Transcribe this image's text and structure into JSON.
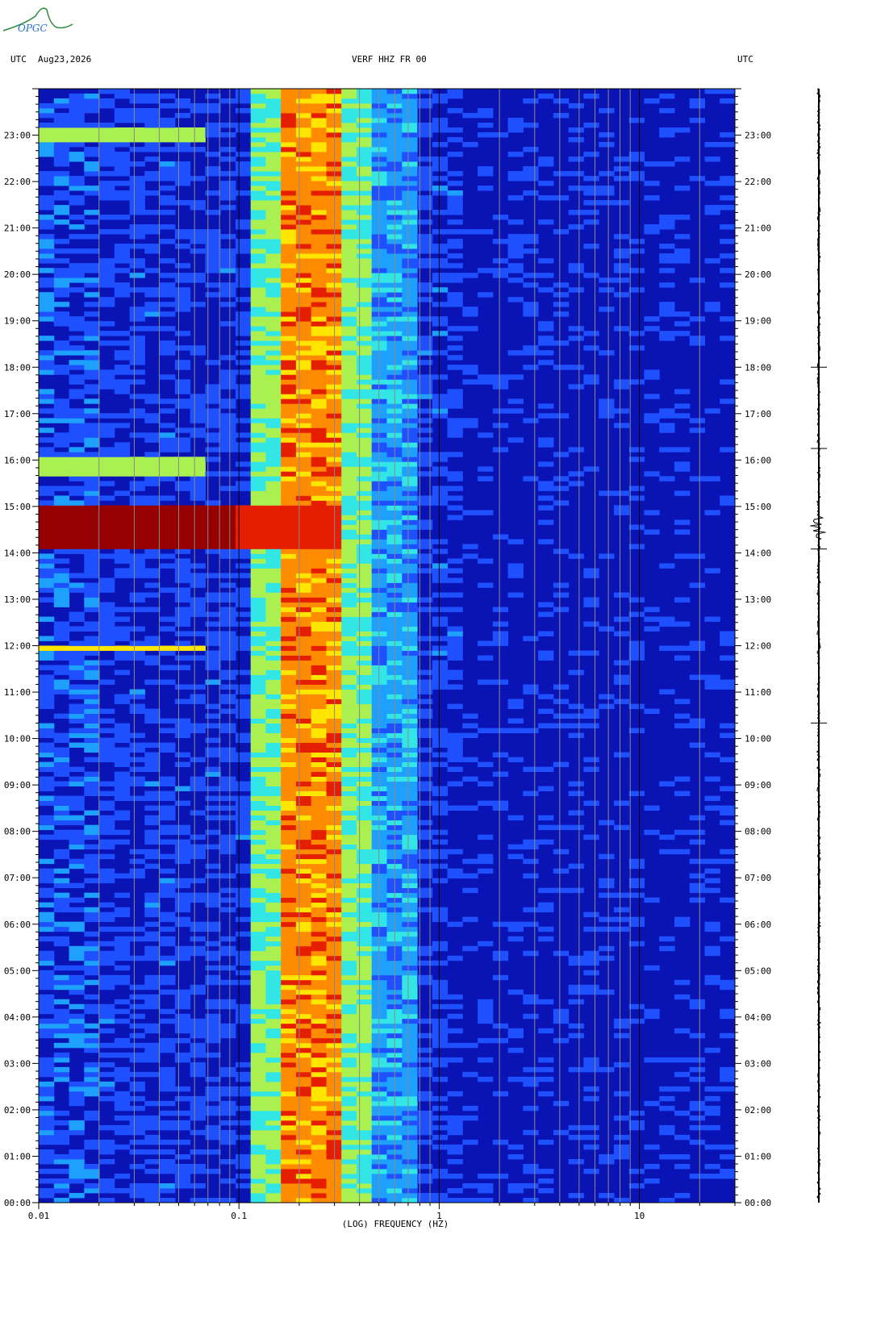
{
  "logo_text": "OPGC",
  "header": {
    "left_tz": "UTC",
    "date": "Aug23,2026",
    "station": "VERF HHZ FR 00",
    "right_tz": "UTC"
  },
  "chart_data": {
    "type": "heatmap",
    "title": "VERF HHZ FR 00",
    "xlabel": "(LOG) FREQUENCY (HZ)",
    "ylabel": "",
    "x_scale": "log",
    "xlim": [
      0.01,
      30
    ],
    "x_tick_labels": [
      "0.01",
      "0.1",
      "1",
      "10"
    ],
    "x_ticks": [
      0.01,
      0.1,
      1,
      10
    ],
    "y_tick_labels": [
      "00:00",
      "01:00",
      "02:00",
      "03:00",
      "04:00",
      "05:00",
      "06:00",
      "07:00",
      "08:00",
      "09:00",
      "10:00",
      "11:00",
      "12:00",
      "13:00",
      "14:00",
      "15:00",
      "16:00",
      "17:00",
      "18:00",
      "19:00",
      "20:00",
      "21:00",
      "22:00",
      "23:00"
    ],
    "ylim_hours": [
      0,
      24
    ],
    "grid": true,
    "colormap": [
      "#0a14b4",
      "#1e50ff",
      "#1ea0ff",
      "#32e6e6",
      "#aaf050",
      "#ffe600",
      "#ff8c00",
      "#e61e00",
      "#960000"
    ],
    "bands": [
      {
        "name": "microseism",
        "f_low": 0.17,
        "f_high": 0.32,
        "level": 0.75
      },
      {
        "name": "microseism-shoulder",
        "f_low": 0.11,
        "f_high": 0.5,
        "level": 0.45
      }
    ],
    "events": [
      {
        "time": "14:35",
        "f_max": 0.32,
        "level": 1.0,
        "duration_h": 0.95
      },
      {
        "time": "15:50",
        "f_max": 0.07,
        "level": 0.5,
        "duration_h": 0.4
      },
      {
        "time": "23:00",
        "f_max": 0.07,
        "level": 0.55,
        "duration_h": 0.25
      },
      {
        "time": "11:55",
        "f_max": 0.07,
        "level": 0.6,
        "duration_h": 0.1
      }
    ],
    "trace_markers": [
      "18:00",
      "16:15",
      "14:05",
      "10:20"
    ]
  }
}
